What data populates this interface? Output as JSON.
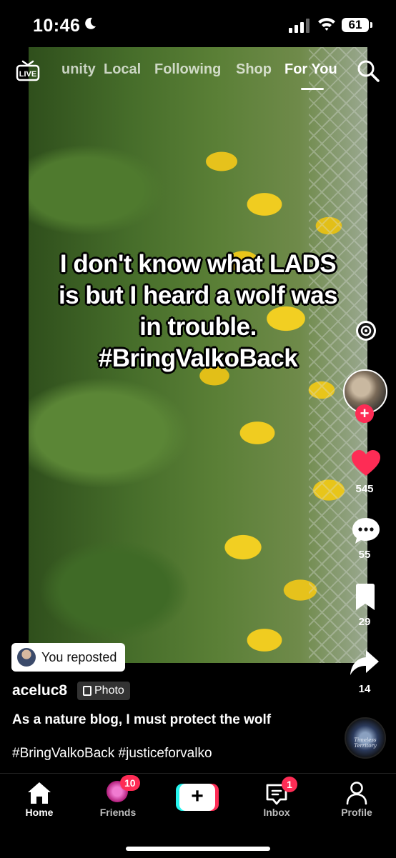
{
  "status_bar": {
    "time": "10:46",
    "battery": "61"
  },
  "top_nav": {
    "tabs": [
      {
        "label": "unity"
      },
      {
        "label": "Local"
      },
      {
        "label": "Following"
      },
      {
        "label": "Shop"
      },
      {
        "label": "For You"
      }
    ],
    "active_tab": "For You"
  },
  "post": {
    "overlay_text": [
      "I don't know what LADS",
      "is but I heard a wolf was",
      "in trouble.",
      "#BringValkoBack"
    ],
    "likes": "545",
    "comments": "55",
    "bookmarks": "29",
    "shares": "14",
    "reposted_label": "You reposted",
    "username": "aceluc8",
    "type_badge": "Photo",
    "description": "As a nature blog, I must protect the wolf",
    "hashtags": "#BringValkoBack #justiceforvalko",
    "music_disc_text": "Timeless Territory"
  },
  "bottom_nav": {
    "home": "Home",
    "friends": "Friends",
    "friends_badge": "10",
    "inbox": "Inbox",
    "inbox_badge": "1",
    "profile": "Profile"
  },
  "colors": {
    "accent_red": "#fe2c55",
    "accent_cyan": "#25f4ee"
  }
}
